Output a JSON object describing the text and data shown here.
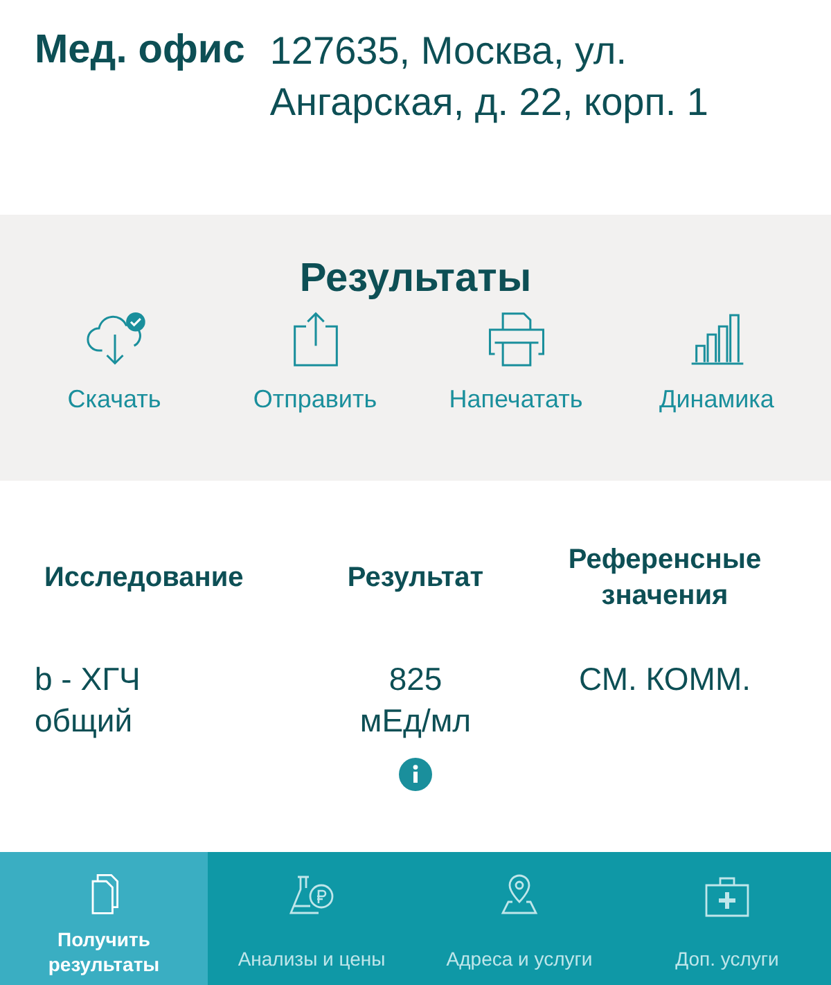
{
  "office": {
    "label": "Мед. офис",
    "address": "127635, Москва, ул. Ангарская, д. 22, корп. 1"
  },
  "results": {
    "title": "Результаты",
    "actions": [
      {
        "kind": "download",
        "label": "Скачать"
      },
      {
        "kind": "share",
        "label": "Отправить"
      },
      {
        "kind": "print",
        "label": "Напечатать"
      },
      {
        "kind": "chart",
        "label": "Динамика"
      }
    ]
  },
  "table": {
    "columns": [
      "Исследование",
      "Результат",
      "Референсные значения"
    ],
    "rows": [
      {
        "test": "b - ХГЧ общий",
        "result": "825 мЕд/мл",
        "reference": "СМ. КОММ.",
        "info": true
      }
    ]
  },
  "nav": [
    {
      "kind": "results",
      "label": "Получить результаты",
      "selected": true
    },
    {
      "kind": "tests",
      "label": "Анализы и цены",
      "selected": false
    },
    {
      "kind": "places",
      "label": "Адреса и услуги",
      "selected": false
    },
    {
      "kind": "services",
      "label": "Доп. услуги",
      "selected": false
    }
  ]
}
